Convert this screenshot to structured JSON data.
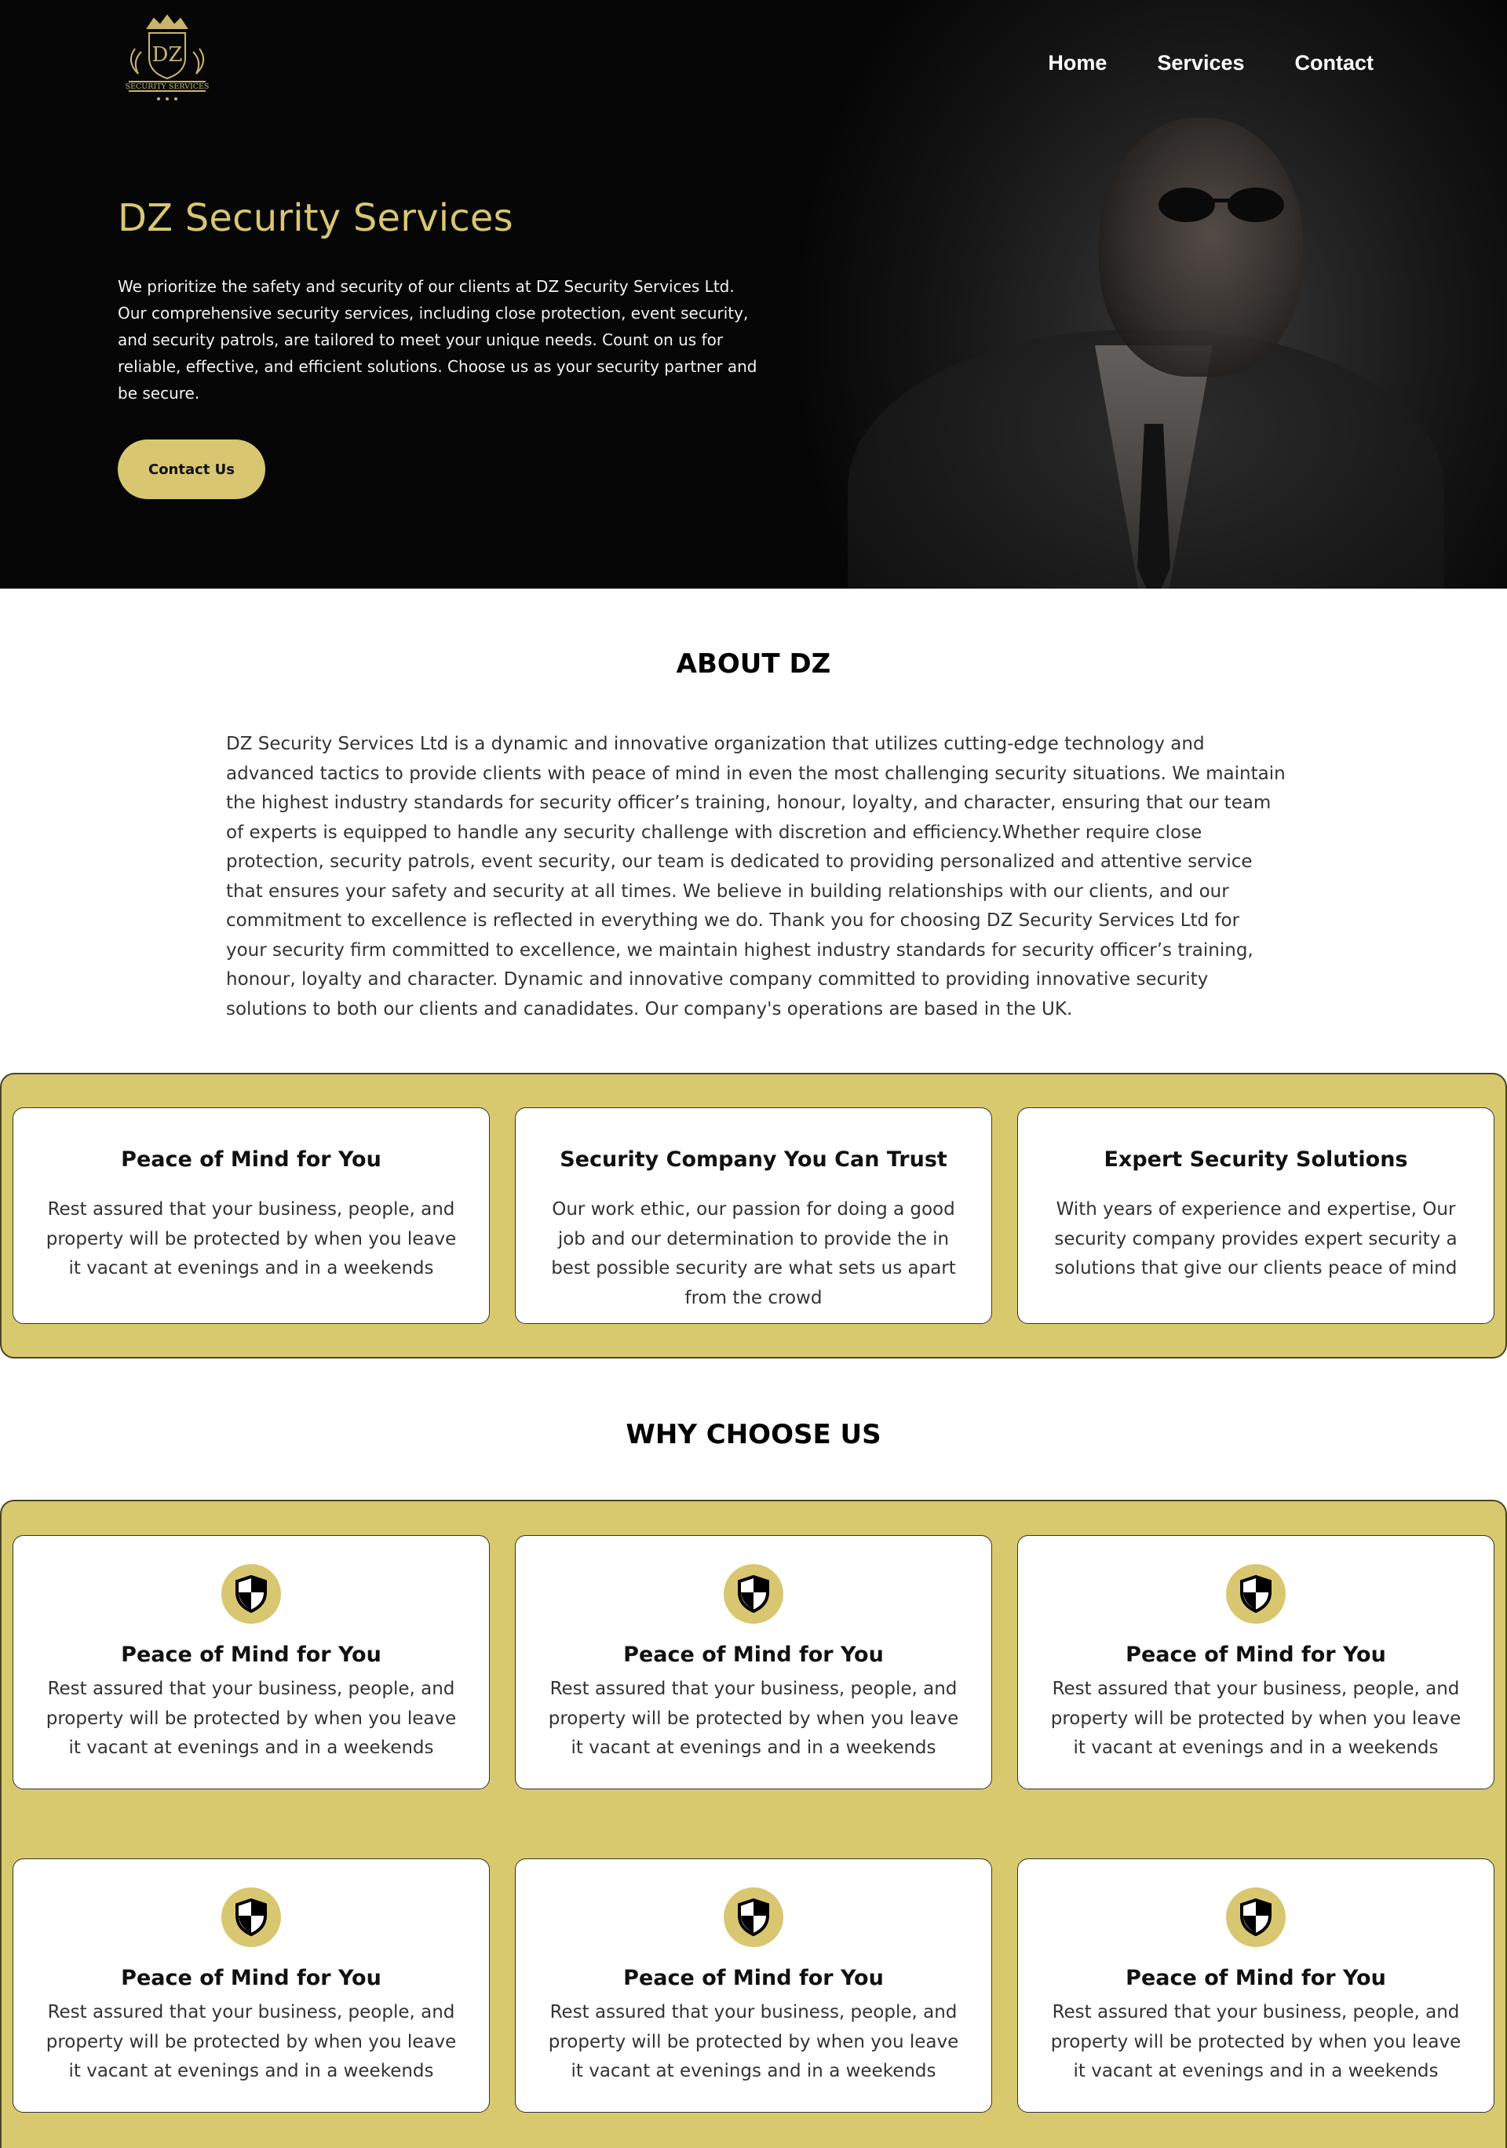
{
  "header": {
    "logo_text": "DZ",
    "logo_sub": "SECURITY SERVICES",
    "nav": [
      "Home",
      "Services",
      "Contact"
    ]
  },
  "hero": {
    "title": "DZ Security Services",
    "text": "We prioritize the safety and security of our clients at DZ Security Services Ltd. Our comprehensive security services, including close protection, event security, and security patrols, are tailored to meet your unique needs. Count on us for reliable, effective, and efficient solutions. Choose us as your security partner and be secure.",
    "button_label": "Contact Us"
  },
  "about": {
    "title": "ABOUT DZ",
    "text": "DZ Security Services Ltd is a dynamic and innovative organization that utilizes cutting-edge technology and advanced tactics to provide clients with peace of mind in even the most challenging security situations. We maintain the highest industry standards for security officer’s training, honour, loyalty, and character, ensuring that our team of experts is equipped to handle any security challenge with discretion and efficiency.Whether require close protection, security patrols, event security, our team is dedicated to providing personalized and attentive service that ensures your safety and security at all times. We believe in building relationships with our clients, and our commitment to excellence is reflected in everything we do. Thank you for choosing DZ Security Services Ltd for your security firm committed to excellence, we maintain highest industry standards for security officer’s training, honour, loyalty and character. Dynamic and innovative company committed to providing innovative security solutions to both our clients and canadidates. Our company's operations are based in the UK."
  },
  "features": [
    {
      "title": "Peace of Mind for You",
      "text": "Rest assured that your business, people, and property will be protected by when you leave it vacant at evenings and in a weekends"
    },
    {
      "title": "Security Company You Can Trust",
      "text": "Our work ethic, our passion for doing a good job and our determination to provide the in best possible security are what sets us apart from the crowd"
    },
    {
      "title": "Expert Security Solutions",
      "text": "With years of experience and expertise, Our security company provides expert security a solutions that give our clients peace of mind"
    }
  ],
  "why": {
    "title": "WHY CHOOSE US",
    "items": [
      {
        "icon": "shield-icon",
        "title": "Peace of Mind for You",
        "text": "Rest assured that your business, people, and property will be protected by when you leave it vacant at evenings and in a weekends"
      },
      {
        "icon": "shield-icon",
        "title": "Peace of Mind for You",
        "text": "Rest assured that your business, people, and property will be protected by when you leave it vacant at evenings and in a weekends"
      },
      {
        "icon": "shield-icon",
        "title": "Peace of Mind for You",
        "text": "Rest assured that your business, people, and property will be protected by when you leave it vacant at evenings and in a weekends"
      },
      {
        "icon": "shield-icon",
        "title": "Peace of Mind for You",
        "text": "Rest assured that your business, people, and property will be protected by when you leave it vacant at evenings and in a weekends"
      },
      {
        "icon": "shield-icon",
        "title": "Peace of Mind for You",
        "text": "Rest assured that your business, people, and property will be protected by when you leave it vacant at evenings and in a weekends"
      },
      {
        "icon": "shield-icon",
        "title": "Peace of Mind for You",
        "text": "Rest assured that your business, people, and property will be protected by when you leave it vacant at evenings and in a weekends"
      }
    ]
  },
  "colors": {
    "accent_gold": "#d8c770",
    "hero_bg": "#060606",
    "text_dark": "#111111"
  }
}
